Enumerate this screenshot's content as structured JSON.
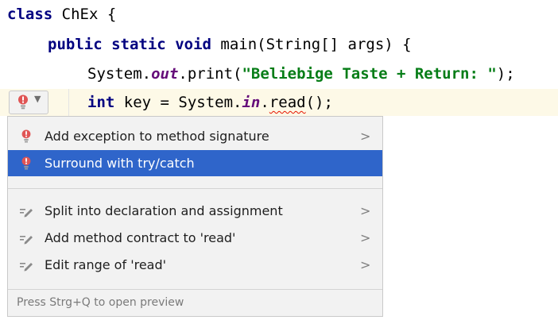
{
  "colors": {
    "keyword": "#000080",
    "string": "#067d17",
    "static_field": "#660e7a",
    "error_underline": "#e51400",
    "caret_line": "#fdf9e7",
    "selection": "#2f65ca",
    "popup_bg": "#f2f2f2",
    "bulb_red": "#e05555"
  },
  "editor": {
    "line1": {
      "kw": "class",
      "rest": " ChEx {"
    },
    "line2": {
      "kw1": "public",
      "kw2": "static",
      "kw3": "void",
      "rest": " main(String[] args) {"
    },
    "line3": {
      "pre": "System.",
      "field": "out",
      "mid": ".print(",
      "str": "\"Beliebige Taste + Return: \"",
      "post": ");"
    },
    "line4": {
      "kw": "int",
      "pre": " key = System.",
      "field": "in",
      "dot": ".",
      "err": "read",
      "post": "();"
    }
  },
  "intention_button": {
    "icon": "red-bulb-icon",
    "dropdown_icon": "chevron-down-icon"
  },
  "popup": {
    "items": [
      {
        "label": "Add exception to method signature",
        "icon": "red-bulb-icon",
        "arrow": ">"
      },
      {
        "label": "Surround with try/catch",
        "icon": "red-bulb-icon",
        "arrow": "",
        "selected": true
      },
      {
        "label": "Split into declaration and assignment",
        "icon": "edit-pencil-icon",
        "arrow": ">"
      },
      {
        "label": "Add method contract to 'read'",
        "icon": "edit-pencil-icon",
        "arrow": ">"
      },
      {
        "label": "Edit range of 'read'",
        "icon": "edit-pencil-icon",
        "arrow": ">"
      }
    ],
    "footer": "Press Strg+Q to open preview"
  }
}
